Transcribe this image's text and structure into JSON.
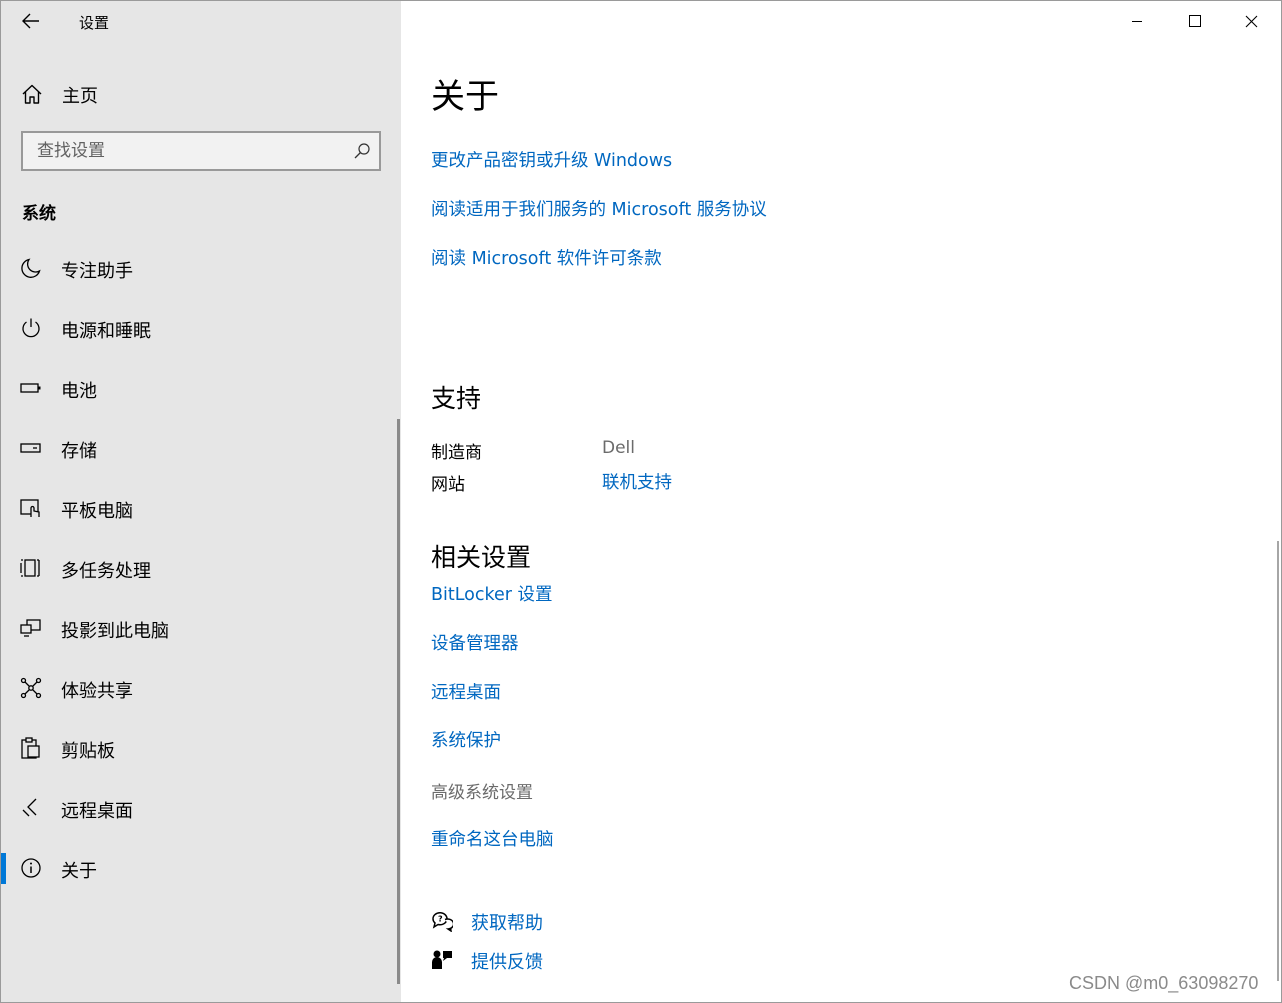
{
  "window": {
    "app_title": "设置",
    "controls": {
      "minimize": "minimize",
      "maximize": "maximize",
      "close": "close"
    }
  },
  "sidebar": {
    "home_label": "主页",
    "search": {
      "placeholder": "查找设置",
      "value": ""
    },
    "section_title": "系统",
    "items": [
      {
        "label": "专注助手",
        "icon": "moon-icon",
        "active": false
      },
      {
        "label": "电源和睡眠",
        "icon": "power-icon",
        "active": false
      },
      {
        "label": "电池",
        "icon": "battery-icon",
        "active": false
      },
      {
        "label": "存储",
        "icon": "storage-drive-icon",
        "active": false
      },
      {
        "label": "平板电脑",
        "icon": "tablet-icon",
        "active": false
      },
      {
        "label": "多任务处理",
        "icon": "multitasking-icon",
        "active": false
      },
      {
        "label": "投影到此电脑",
        "icon": "projection-icon",
        "active": false
      },
      {
        "label": "体验共享",
        "icon": "shared-experiences-icon",
        "active": false
      },
      {
        "label": "剪贴板",
        "icon": "clipboard-icon",
        "active": false
      },
      {
        "label": "远程桌面",
        "icon": "remote-desktop-icon",
        "active": false
      },
      {
        "label": "关于",
        "icon": "info-icon",
        "active": true
      }
    ]
  },
  "main": {
    "title": "关于",
    "top_links": [
      "更改产品密钥或升级 Windows",
      "阅读适用于我们服务的 Microsoft 服务协议",
      "阅读 Microsoft 软件许可条款"
    ],
    "support": {
      "heading": "支持",
      "manufacturer_label": "制造商",
      "manufacturer_value": "Dell",
      "website_label": "网站",
      "website_link": "联机支持"
    },
    "related": {
      "heading": "相关设置",
      "links": [
        "BitLocker 设置",
        "设备管理器",
        "远程桌面",
        "系统保护"
      ],
      "advanced_label": "高级系统设置",
      "rename_link": "重命名这台电脑"
    },
    "help": {
      "get_help": "获取帮助",
      "feedback": "提供反馈"
    }
  },
  "watermark": "CSDN @m0_63098270",
  "colors": {
    "accent": "#0078d7",
    "link": "#0067c0",
    "sidebar_bg": "#e6e6e6"
  }
}
